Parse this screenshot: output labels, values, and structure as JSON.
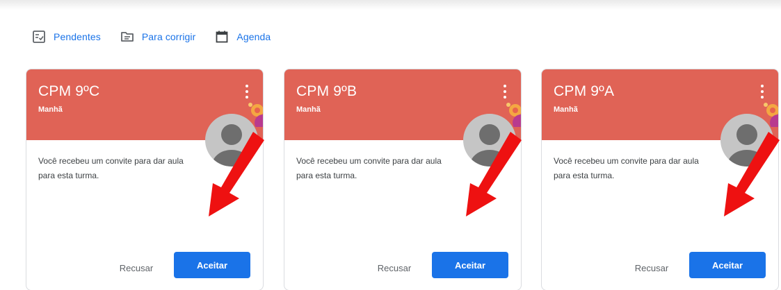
{
  "nav": {
    "items": [
      {
        "label": "Pendentes",
        "icon": "pending-checklist-icon"
      },
      {
        "label": "Para corrigir",
        "icon": "review-tray-icon"
      },
      {
        "label": "Agenda",
        "icon": "calendar-icon"
      }
    ]
  },
  "cards": [
    {
      "title": "CPM 9ºC",
      "subtitle": "Manhã",
      "invite_text": "Você recebeu um convite para dar aula para esta turma.",
      "refuse_label": "Recusar",
      "accept_label": "Aceitar"
    },
    {
      "title": "CPM 9ºB",
      "subtitle": "Manhã",
      "invite_text": "Você recebeu um convite para dar aula para esta turma.",
      "refuse_label": "Recusar",
      "accept_label": "Aceitar"
    },
    {
      "title": "CPM 9ºA",
      "subtitle": "Manhã",
      "invite_text": "Você recebeu um convite para dar aula para esta turma.",
      "refuse_label": "Recusar",
      "accept_label": "Aceitar"
    }
  ],
  "colors": {
    "header": "#e06356",
    "accent": "#1a73e8",
    "arrow": "#ee1111"
  }
}
